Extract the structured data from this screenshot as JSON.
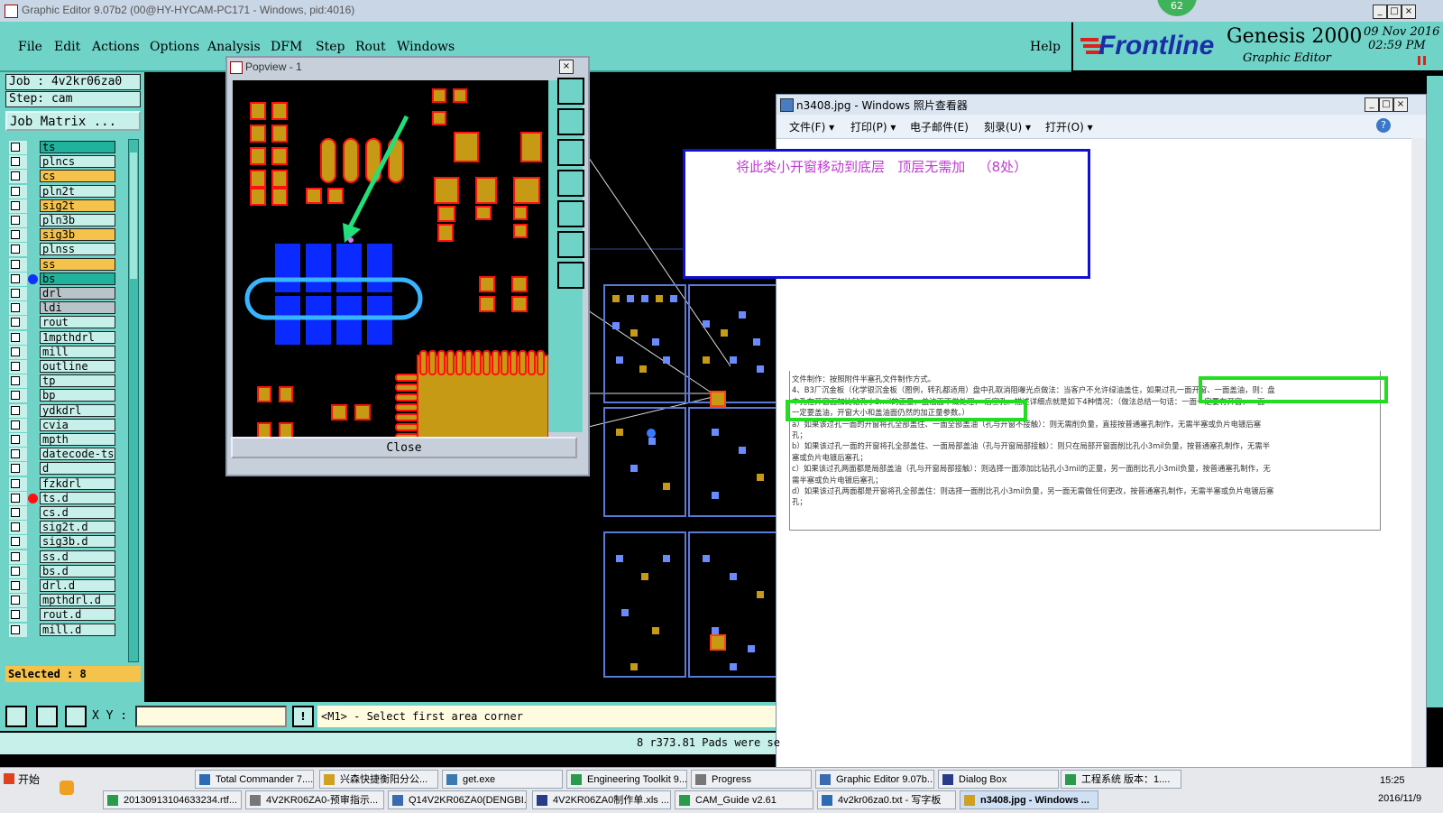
{
  "window": {
    "title": "Graphic Editor 9.07b2 (00@HY-HYCAM-PC171 - Windows, pid:4016)",
    "badge": "62"
  },
  "menu": {
    "items": [
      "File",
      "Edit",
      "Actions",
      "Options",
      "Analysis",
      "DFM",
      "Step",
      "Rout",
      "Windows"
    ],
    "help": "Help"
  },
  "brand": {
    "logo": "Frontline",
    "product": "Genesis 2000",
    "subtitle": "Graphic Editor",
    "date": "09 Nov 2016",
    "time": "02:59 PM"
  },
  "job": {
    "job_label": "Job : 4v2kr06za0",
    "step_label": "Step: cam",
    "matrix_button": "Job Matrix ..."
  },
  "layers": [
    {
      "name": "ts",
      "color": "#1fb39e",
      "dot": ""
    },
    {
      "name": "plncs",
      "color": "#c7f0ea",
      "dot": ""
    },
    {
      "name": "cs",
      "color": "#f5c24b",
      "dot": ""
    },
    {
      "name": "pln2t",
      "color": "#c7f0ea",
      "dot": ""
    },
    {
      "name": "sig2t",
      "color": "#f5c24b",
      "dot": ""
    },
    {
      "name": "pln3b",
      "color": "#c7f0ea",
      "dot": ""
    },
    {
      "name": "sig3b",
      "color": "#f5c24b",
      "dot": ""
    },
    {
      "name": "plnss",
      "color": "#c7f0ea",
      "dot": ""
    },
    {
      "name": "ss",
      "color": "#f5c24b",
      "dot": ""
    },
    {
      "name": "bs",
      "color": "#1fb39e",
      "dot": "#1030ff"
    },
    {
      "name": "drl",
      "color": "#b8c4c8",
      "dot": ""
    },
    {
      "name": "ldi",
      "color": "#b8c4c8",
      "dot": ""
    },
    {
      "name": "rout",
      "color": "#c7f0ea",
      "dot": ""
    },
    {
      "name": "1mpthdrl",
      "color": "#c7f0ea",
      "dot": ""
    },
    {
      "name": "mill",
      "color": "#c7f0ea",
      "dot": ""
    },
    {
      "name": "outline",
      "color": "#c7f0ea",
      "dot": ""
    },
    {
      "name": "tp",
      "color": "#c7f0ea",
      "dot": ""
    },
    {
      "name": "bp",
      "color": "#c7f0ea",
      "dot": ""
    },
    {
      "name": "ydkdrl",
      "color": "#c7f0ea",
      "dot": ""
    },
    {
      "name": "cvia",
      "color": "#c7f0ea",
      "dot": ""
    },
    {
      "name": "mpth",
      "color": "#c7f0ea",
      "dot": ""
    },
    {
      "name": "datecode-ts",
      "color": "#c7f0ea",
      "dot": ""
    },
    {
      "name": "d",
      "color": "#c7f0ea",
      "dot": ""
    },
    {
      "name": "fzkdrl",
      "color": "#c7f0ea",
      "dot": ""
    },
    {
      "name": "ts.d",
      "color": "#c7f0ea",
      "dot": "#ff1010"
    },
    {
      "name": "cs.d",
      "color": "#c7f0ea",
      "dot": ""
    },
    {
      "name": "sig2t.d",
      "color": "#c7f0ea",
      "dot": ""
    },
    {
      "name": "sig3b.d",
      "color": "#c7f0ea",
      "dot": ""
    },
    {
      "name": "ss.d",
      "color": "#c7f0ea",
      "dot": ""
    },
    {
      "name": "bs.d",
      "color": "#c7f0ea",
      "dot": ""
    },
    {
      "name": "drl.d",
      "color": "#c7f0ea",
      "dot": ""
    },
    {
      "name": "mpthdrl.d",
      "color": "#c7f0ea",
      "dot": ""
    },
    {
      "name": "rout.d",
      "color": "#c7f0ea",
      "dot": ""
    },
    {
      "name": "mill.d",
      "color": "#c7f0ea",
      "dot": ""
    }
  ],
  "selected": "Selected : 8",
  "popview": {
    "title": "Popview - 1",
    "close_label": "Close"
  },
  "command": {
    "xy_label": "X Y :",
    "xy_value": "",
    "prompt": "<M1> - Select first area corner"
  },
  "status": {
    "message": "8 r373.81 Pads were se"
  },
  "viewer": {
    "title": "n3408.jpg - Windows 照片查看器",
    "menu": [
      "文件(F) ▾",
      "打印(P) ▾",
      "电子邮件(E)",
      "刻录(U) ▾",
      "打开(O) ▾"
    ],
    "note": "将此类小开窗移动到底层   顶层无需加   （8处）",
    "doc_lines": [
      "文件制作：按照附件半塞孔文件制作方式。",
      "4、B3厂沉金板（化学银沉金板（图例，转孔都适用）盘中孔取消阻曝光点做法：当客户不允许绿油盖住，如果过孔一面开窗、一面盖油，则：盘",
      "中孔在开窗面加比钻孔小3mil的正量，盖油面不做处理，     后塞孔。描述详细点就是如下4种情况：（做法总结一句话：一面一定要有开窗，一面",
      "一定要盖油，开窗大小和盖油面仍然的加正量参数。）",
      "a）如果该过孔一面的开窗将孔全部盖住、一面全部盖油（孔与开窗不接触）：则无需削负量，直接按普通塞孔制作，无需半塞或负片电镀后塞",
      "孔；",
      "b）如果该过孔一面的开窗将孔全部盖住、一面局部盖油（孔与开窗局部接触）：则只在局部开窗面削比孔小3mil负量，按普通塞孔制作，无需半",
      "塞或负片电镀后塞孔；",
      "c）如果该过孔两面都是局部盖油（孔与开窗局部接触）：则选择一面添加比钻孔小3mil的正量，另一面削比孔小3mil负量，按普通塞孔制作，无",
      "需半塞或负片电镀后塞孔；",
      "d）如果该过孔两面都是开窗将孔全部盖住：则选择一面削比孔小3mil负量，另一面无需做任何更改，按普通塞孔制作，无需半塞或负片电镀后塞",
      "孔；"
    ]
  },
  "taskbar": {
    "start": "开始",
    "row1": [
      "Total Commander 7....",
      "兴森快捷衡阳分公...",
      "get.exe",
      "Engineering Toolkit 9...",
      "Progress",
      "Graphic Editor 9.07b...",
      "Dialog Box",
      "工程系统  版本：1...."
    ],
    "row2": [
      "20130913104633234.rtf...",
      "4V2KR06ZA0-预审指示...",
      "Q14V2KR06ZA0(DENGBI...",
      "4V2KR06ZA0制作单.xls ...",
      "CAM_Guide v2.61",
      "4v2kr06za0.txt - 写字板",
      "n3408.jpg - Windows ..."
    ],
    "clock_time": "15:25",
    "clock_date": "2016/11/9"
  }
}
